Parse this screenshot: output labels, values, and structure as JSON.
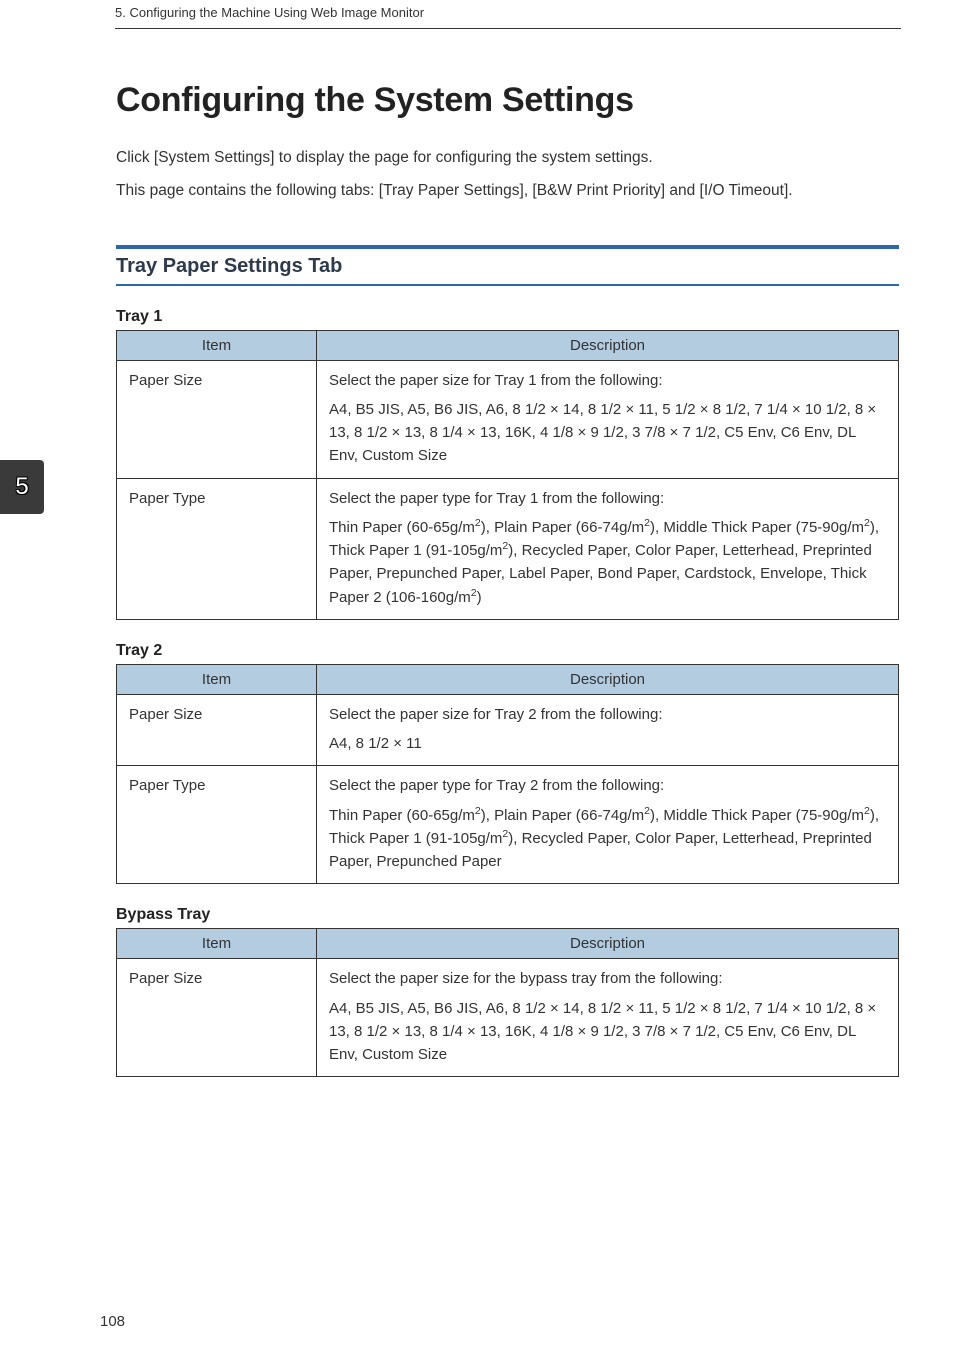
{
  "header": {
    "breadcrumb": "5. Configuring the Machine Using Web Image Monitor"
  },
  "chapter_tab": "5",
  "page_number": "108",
  "title": "Configuring the System Settings",
  "intro": [
    "Click [System Settings] to display the page for configuring the system settings.",
    "This page contains the following tabs: [Tray Paper Settings], [B&W Print Priority] and [I/O Timeout]."
  ],
  "section_header": "Tray Paper Settings Tab",
  "table_headers": {
    "item": "Item",
    "desc": "Description"
  },
  "tables": [
    {
      "caption": "Tray 1",
      "rows": [
        {
          "item": "Paper Size",
          "desc": [
            "Select the paper size for Tray 1 from the following:",
            "A4, B5 JIS, A5, B6 JIS, A6, 8 1/2 × 14, 8 1/2 × 11, 5 1/2 × 8 1/2, 7 1/4 × 10 1/2, 8 × 13, 8 1/2 × 13, 8 1/4 × 13, 16K, 4 1/8 × 9 1/2, 3 7/8 × 7 1/2, C5 Env, C6 Env, DL Env, Custom Size"
          ]
        },
        {
          "item": "Paper Type",
          "desc_html": "Select the paper type for Tray 1 from the following:|Thin Paper (60-65g/m<sup>2</sup>), Plain Paper (66-74g/m<sup>2</sup>), Middle Thick Paper (75-90g/m<sup>2</sup>), Thick Paper 1 (91-105g/m<sup>2</sup>), Recycled Paper, Color Paper, Letterhead, Preprinted Paper, Prepunched Paper, Label Paper, Bond Paper, Cardstock, Envelope, Thick Paper 2 (106-160g/m<sup>2</sup>)"
        }
      ]
    },
    {
      "caption": "Tray 2",
      "rows": [
        {
          "item": "Paper Size",
          "desc": [
            "Select the paper size for Tray 2 from the following:",
            "A4, 8 1/2 × 11"
          ]
        },
        {
          "item": "Paper Type",
          "desc_html": "Select the paper type for Tray 2 from the following:|Thin Paper (60-65g/m<sup>2</sup>), Plain Paper (66-74g/m<sup>2</sup>), Middle Thick Paper (75-90g/m<sup>2</sup>), Thick Paper 1 (91-105g/m<sup>2</sup>), Recycled Paper, Color Paper, Letterhead, Preprinted Paper, Prepunched Paper"
        }
      ]
    },
    {
      "caption": "Bypass Tray",
      "rows": [
        {
          "item": "Paper Size",
          "desc": [
            "Select the paper size for the bypass tray from the following:",
            "A4, B5 JIS, A5, B6 JIS, A6, 8 1/2 × 14, 8 1/2 × 11, 5 1/2 × 8 1/2, 7 1/4 × 10 1/2, 8 × 13, 8 1/2 × 13, 8 1/4 × 13, 16K, 4 1/8 × 9 1/2, 3 7/8 × 7 1/2, C5 Env, C6 Env, DL Env, Custom Size"
          ]
        }
      ]
    }
  ]
}
